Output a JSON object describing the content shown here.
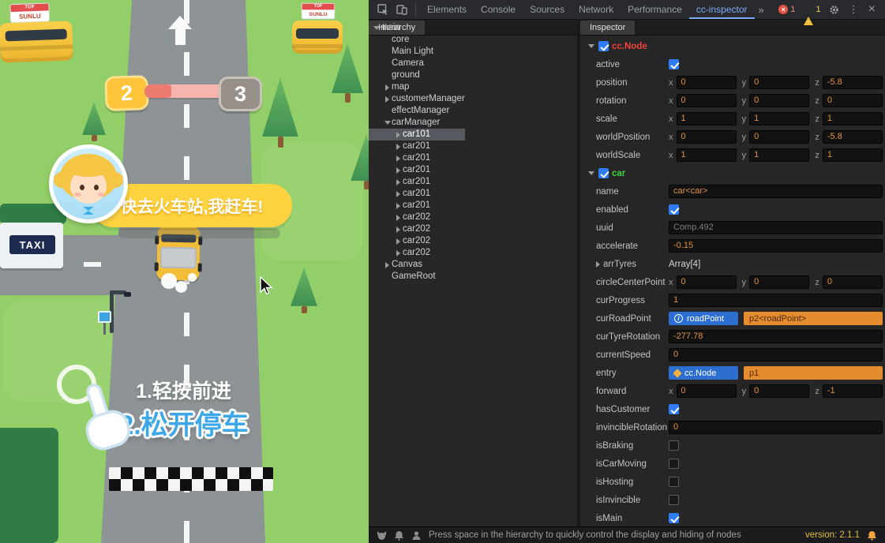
{
  "game": {
    "buses": [
      {
        "sign": "SUNLU",
        "tag": "TOP"
      },
      {
        "sign": "SUNLU",
        "tag": "TOP"
      }
    ],
    "progress": {
      "current": "2",
      "next": "3"
    },
    "speech_bubble": "快去火车站,我赶车!",
    "taxi_sign": "TAXI",
    "instructions": {
      "line1": "1.轻按前进",
      "line2": "2.松开停车"
    }
  },
  "devtools": {
    "toolbar": {
      "tabs": [
        {
          "label": "Elements",
          "selected": false
        },
        {
          "label": "Console",
          "selected": false
        },
        {
          "label": "Sources",
          "selected": false
        },
        {
          "label": "Network",
          "selected": false
        },
        {
          "label": "Performance",
          "selected": false
        },
        {
          "label": "cc-inspector",
          "selected": true
        }
      ],
      "more_tabs": "»",
      "error_count": "1",
      "warning_count": "1"
    },
    "hierarchy": {
      "tab_label": "Hierarchy",
      "nodes": [
        {
          "label": "main",
          "depth": 0,
          "arrow": "expanded",
          "selected": false
        },
        {
          "label": "core",
          "depth": 1,
          "arrow": "none",
          "selected": false
        },
        {
          "label": "Main Light",
          "depth": 1,
          "arrow": "none",
          "selected": false
        },
        {
          "label": "Camera",
          "depth": 1,
          "arrow": "none",
          "selected": false
        },
        {
          "label": "ground",
          "depth": 1,
          "arrow": "none",
          "selected": false
        },
        {
          "label": "map",
          "depth": 1,
          "arrow": "collapsed",
          "selected": false
        },
        {
          "label": "customerManager",
          "depth": 1,
          "arrow": "collapsed",
          "selected": false
        },
        {
          "label": "effectManager",
          "depth": 1,
          "arrow": "none",
          "selected": false
        },
        {
          "label": "carManager",
          "depth": 1,
          "arrow": "expanded",
          "selected": false
        },
        {
          "label": "car101",
          "depth": 2,
          "arrow": "collapsed",
          "selected": true
        },
        {
          "label": "car201",
          "depth": 2,
          "arrow": "collapsed",
          "selected": false
        },
        {
          "label": "car201",
          "depth": 2,
          "arrow": "collapsed",
          "selected": false
        },
        {
          "label": "car201",
          "depth": 2,
          "arrow": "collapsed",
          "selected": false
        },
        {
          "label": "car201",
          "depth": 2,
          "arrow": "collapsed",
          "selected": false
        },
        {
          "label": "car201",
          "depth": 2,
          "arrow": "collapsed",
          "selected": false
        },
        {
          "label": "car201",
          "depth": 2,
          "arrow": "collapsed",
          "selected": false
        },
        {
          "label": "car202",
          "depth": 2,
          "arrow": "collapsed",
          "selected": false
        },
        {
          "label": "car202",
          "depth": 2,
          "arrow": "collapsed",
          "selected": false
        },
        {
          "label": "car202",
          "depth": 2,
          "arrow": "collapsed",
          "selected": false
        },
        {
          "label": "car202",
          "depth": 2,
          "arrow": "collapsed",
          "selected": false
        },
        {
          "label": "Canvas",
          "depth": 1,
          "arrow": "collapsed",
          "selected": false
        },
        {
          "label": "GameRoot",
          "depth": 1,
          "arrow": "none",
          "selected": false
        }
      ]
    },
    "inspector": {
      "tab_label": "Inspector",
      "axes": [
        "x",
        "y",
        "z"
      ],
      "rows": [
        {
          "type": "component",
          "label": "cc.Node",
          "checked": true,
          "color": "#ef4339"
        },
        {
          "type": "checkbox",
          "label": "active",
          "checked": true
        },
        {
          "type": "vec3",
          "label": "position",
          "x": "0",
          "y": "0",
          "z": "-5.8"
        },
        {
          "type": "vec3",
          "label": "rotation",
          "x": "0",
          "y": "0",
          "z": "0"
        },
        {
          "type": "vec3",
          "label": "scale",
          "x": "1",
          "y": "1",
          "z": "1"
        },
        {
          "type": "vec3",
          "label": "worldPosition",
          "x": "0",
          "y": "0",
          "z": "-5.8"
        },
        {
          "type": "vec3",
          "label": "worldScale",
          "x": "1",
          "y": "1",
          "z": "1"
        },
        {
          "type": "component",
          "label": "car",
          "checked": true,
          "color": "#3fd23f"
        },
        {
          "type": "text",
          "label": "name",
          "value": "car<car>"
        },
        {
          "type": "checkbox",
          "label": "enabled",
          "checked": true
        },
        {
          "type": "text",
          "label": "uuid",
          "value": "Comp.492",
          "muted": true
        },
        {
          "type": "text",
          "label": "accelerate",
          "value": "-0.15"
        },
        {
          "type": "array",
          "label": "arrTyres",
          "value": "Array[4]"
        },
        {
          "type": "vec3",
          "label": "circleCenterPoint",
          "x": "0",
          "y": "0",
          "z": "0"
        },
        {
          "type": "text",
          "label": "curProgress",
          "value": "1"
        },
        {
          "type": "ref",
          "label": "curRoadPoint",
          "icon": "info-icon",
          "button": "roadPoint",
          "value": "p2<roadPoint>"
        },
        {
          "type": "text",
          "label": "curTyreRotation",
          "value": "-277.78"
        },
        {
          "type": "text",
          "label": "currentSpeed",
          "value": "0"
        },
        {
          "type": "ref",
          "label": "entry",
          "icon": "node-icon",
          "button": "cc.Node",
          "value": "p1"
        },
        {
          "type": "vec3",
          "label": "forward",
          "x": "0",
          "y": "0",
          "z": "-1"
        },
        {
          "type": "checkbox",
          "label": "hasCustomer",
          "checked": true
        },
        {
          "type": "text",
          "label": "invincibleRotation",
          "value": "0"
        },
        {
          "type": "checkbox",
          "label": "isBraking",
          "checked": false
        },
        {
          "type": "checkbox",
          "label": "isCarMoving",
          "checked": false
        },
        {
          "type": "checkbox",
          "label": "isHosting",
          "checked": false
        },
        {
          "type": "checkbox",
          "label": "isInvincible",
          "checked": false
        },
        {
          "type": "checkbox",
          "label": "isMain",
          "checked": true
        }
      ]
    },
    "statusbar": {
      "message": "Press space in the hierarchy to quickly control the display and hiding of nodes",
      "version": "version: 2.1.1"
    }
  }
}
